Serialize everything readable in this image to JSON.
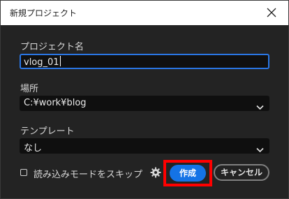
{
  "dialog": {
    "title": "新規プロジェクト"
  },
  "form": {
    "name_label": "プロジェクト名",
    "name_value": "vlog_01",
    "location_label": "場所",
    "location_value": "C:¥work¥blog",
    "template_label": "テンプレート",
    "template_value": "なし",
    "skip_import_label": "読み込みモードをスキップ",
    "skip_import_checked": false
  },
  "buttons": {
    "create_label": "作成",
    "cancel_label": "キャンセル"
  },
  "icons": [
    "close-icon",
    "chevron-down-icon",
    "gear-icon"
  ],
  "colors": {
    "accent": "#1473e6",
    "focus_border": "#2a76e4",
    "highlight": "#ff0000"
  }
}
